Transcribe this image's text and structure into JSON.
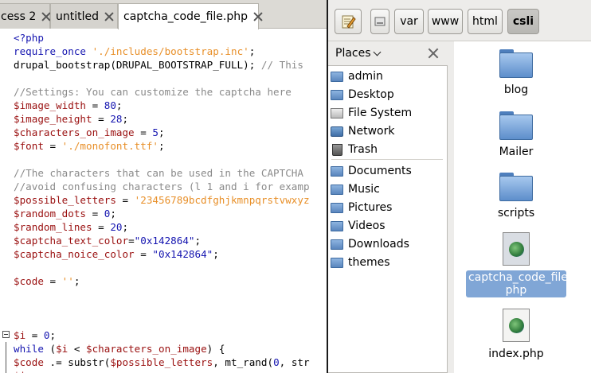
{
  "editor": {
    "tabs": [
      {
        "label": "cess 2"
      },
      {
        "label": "untitled"
      },
      {
        "label": "captcha_code_file.php"
      }
    ],
    "code": [
      [
        {
          "t": "<?php",
          "c": "kw"
        }
      ],
      [
        {
          "t": "require_once",
          "c": "kw"
        },
        {
          "t": " "
        },
        {
          "t": "'./includes/bootstrap.inc'",
          "c": "str"
        },
        {
          "t": ";"
        }
      ],
      [
        {
          "t": "drupal_bootstrap(DRUPAL_BOOTSTRAP_FULL); "
        },
        {
          "t": "// This",
          "c": "cmt"
        }
      ],
      [],
      [
        {
          "t": "//Settings: You can customize the captcha here",
          "c": "cmt"
        }
      ],
      [
        {
          "t": "$image_width",
          "c": "var"
        },
        {
          "t": " = "
        },
        {
          "t": "80",
          "c": "kw"
        },
        {
          "t": ";"
        }
      ],
      [
        {
          "t": "$image_height",
          "c": "var"
        },
        {
          "t": " = "
        },
        {
          "t": "28",
          "c": "kw"
        },
        {
          "t": ";"
        }
      ],
      [
        {
          "t": "$characters_on_image",
          "c": "var"
        },
        {
          "t": " = "
        },
        {
          "t": "5",
          "c": "kw"
        },
        {
          "t": ";"
        }
      ],
      [
        {
          "t": "$font",
          "c": "var"
        },
        {
          "t": " = "
        },
        {
          "t": "'./monofont.ttf'",
          "c": "str"
        },
        {
          "t": ";"
        }
      ],
      [],
      [
        {
          "t": "//The characters that can be used in the CAPTCHA",
          "c": "cmt"
        }
      ],
      [
        {
          "t": "//avoid confusing characters (l 1 and i for examp",
          "c": "cmt"
        }
      ],
      [
        {
          "t": "$possible_letters",
          "c": "var"
        },
        {
          "t": " = "
        },
        {
          "t": "'23456789bcdfghjkmnpqrstvwxyz",
          "c": "str"
        }
      ],
      [
        {
          "t": "$random_dots",
          "c": "var"
        },
        {
          "t": " = "
        },
        {
          "t": "0",
          "c": "kw"
        },
        {
          "t": ";"
        }
      ],
      [
        {
          "t": "$random_lines",
          "c": "var"
        },
        {
          "t": " = "
        },
        {
          "t": "20",
          "c": "kw"
        },
        {
          "t": ";"
        }
      ],
      [
        {
          "t": "$captcha_text_color",
          "c": "var"
        },
        {
          "t": "="
        },
        {
          "t": "\"0x142864\"",
          "c": "kw"
        },
        {
          "t": ";"
        }
      ],
      [
        {
          "t": "$captcha_noice_color",
          "c": "var"
        },
        {
          "t": " = "
        },
        {
          "t": "\"0x142864\"",
          "c": "kw"
        },
        {
          "t": ";"
        }
      ],
      [],
      [
        {
          "t": "$code",
          "c": "var"
        },
        {
          "t": " = "
        },
        {
          "t": "''",
          "c": "str"
        },
        {
          "t": ";"
        }
      ],
      [],
      [],
      [],
      [
        {
          "t": "$i",
          "c": "var"
        },
        {
          "t": " = "
        },
        {
          "t": "0",
          "c": "kw"
        },
        {
          "t": ";"
        }
      ],
      [
        {
          "t": "while",
          "c": "kw"
        },
        {
          "t": " ("
        },
        {
          "t": "$i",
          "c": "var"
        },
        {
          "t": " < "
        },
        {
          "t": "$characters_on_image",
          "c": "var"
        },
        {
          "t": ") {"
        }
      ],
      [
        {
          "t": "$code",
          "c": "var"
        },
        {
          "t": " .= substr("
        },
        {
          "t": "$possible_letters",
          "c": "var"
        },
        {
          "t": ", mt_rand("
        },
        {
          "t": "0",
          "c": "kw"
        },
        {
          "t": ", str"
        }
      ],
      [
        {
          "t": "$i",
          "c": "var"
        },
        {
          "t": "++;"
        }
      ]
    ]
  },
  "file_manager": {
    "toolbar": {
      "crumbs": [
        "var",
        "www",
        "html",
        "csli"
      ]
    },
    "places": {
      "header": "Places",
      "items": [
        {
          "label": "admin",
          "icon": "folder-icon"
        },
        {
          "label": "Desktop",
          "icon": "folder-icon"
        },
        {
          "label": "File System",
          "icon": "drive-icon"
        },
        {
          "label": "Network",
          "icon": "network-icon"
        },
        {
          "label": "Trash",
          "icon": "trash-icon"
        },
        {
          "label": "Documents",
          "icon": "folder-icon"
        },
        {
          "label": "Music",
          "icon": "folder-icon"
        },
        {
          "label": "Pictures",
          "icon": "folder-icon"
        },
        {
          "label": "Videos",
          "icon": "folder-icon"
        },
        {
          "label": "Downloads",
          "icon": "folder-icon"
        },
        {
          "label": "themes",
          "icon": "folder-icon"
        }
      ]
    },
    "files": [
      {
        "name": "blog",
        "type": "folder",
        "selected": false
      },
      {
        "name": "Mailer",
        "type": "folder",
        "selected": false
      },
      {
        "name": "scripts",
        "type": "folder",
        "selected": false
      },
      {
        "name": "captcha_code_file.php",
        "label_lines": [
          "captcha_code_file.",
          "php"
        ],
        "type": "php",
        "selected": true
      },
      {
        "name": "index.php",
        "type": "php",
        "selected": false
      }
    ]
  },
  "colors": {
    "selection": "#80a6d6",
    "keyword": "#1515b0",
    "variable": "#9a1010",
    "string": "#e8902a",
    "comment": "#8a8a8a"
  }
}
